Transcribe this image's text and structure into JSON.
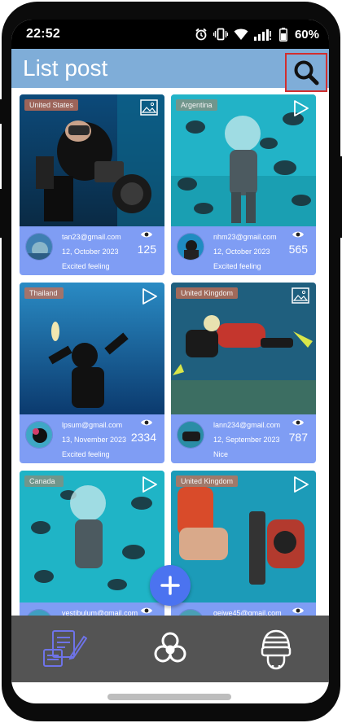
{
  "status_bar": {
    "time": "22:52",
    "battery_text": "60%",
    "icons": [
      "alarm-icon",
      "vibrate-icon",
      "wifi-icon",
      "signal-icon",
      "battery-icon"
    ]
  },
  "app_bar": {
    "title": "List post",
    "search_icon": "search-icon",
    "bg_color": "#7fadd8",
    "highlight_color": "#d22e2e"
  },
  "posts": [
    {
      "country": "United States",
      "media_type": "image",
      "email": "tan23@gmail.com",
      "date": "12, October 2023",
      "views": "125",
      "feeling": "Excited feeling"
    },
    {
      "country": "Argentina",
      "media_type": "video",
      "email": "nhm23@gmail.com",
      "date": "12, October 2023",
      "views": "565",
      "feeling": "Excited feeling"
    },
    {
      "country": "Thailand",
      "media_type": "video",
      "email": "lpsum@gmail.com",
      "date": "13, November 2023",
      "views": "2334",
      "feeling": "Excited feeling"
    },
    {
      "country": "United Kingdom",
      "media_type": "image",
      "email": "lann234@gmail.com",
      "date": "12, September 2023",
      "views": "787",
      "feeling": "Nice"
    },
    {
      "country": "Canada",
      "media_type": "video",
      "email": "vestibulum@gmail.com",
      "date": "",
      "views": "",
      "feeling": ""
    },
    {
      "country": "United Kingdom",
      "media_type": "video",
      "email": "gejwe45@gmail.com",
      "date": "",
      "views": "",
      "feeling": ""
    }
  ],
  "fab": {
    "icon": "plus-icon",
    "color": "#4b73f0"
  },
  "bottom_nav": [
    {
      "icon": "document-edit-icon",
      "active": true
    },
    {
      "icon": "biohazard-icon",
      "active": false
    },
    {
      "icon": "diver-helmet-icon",
      "active": false
    }
  ],
  "colors": {
    "card": "#7f9df4",
    "nav": "#545454"
  }
}
